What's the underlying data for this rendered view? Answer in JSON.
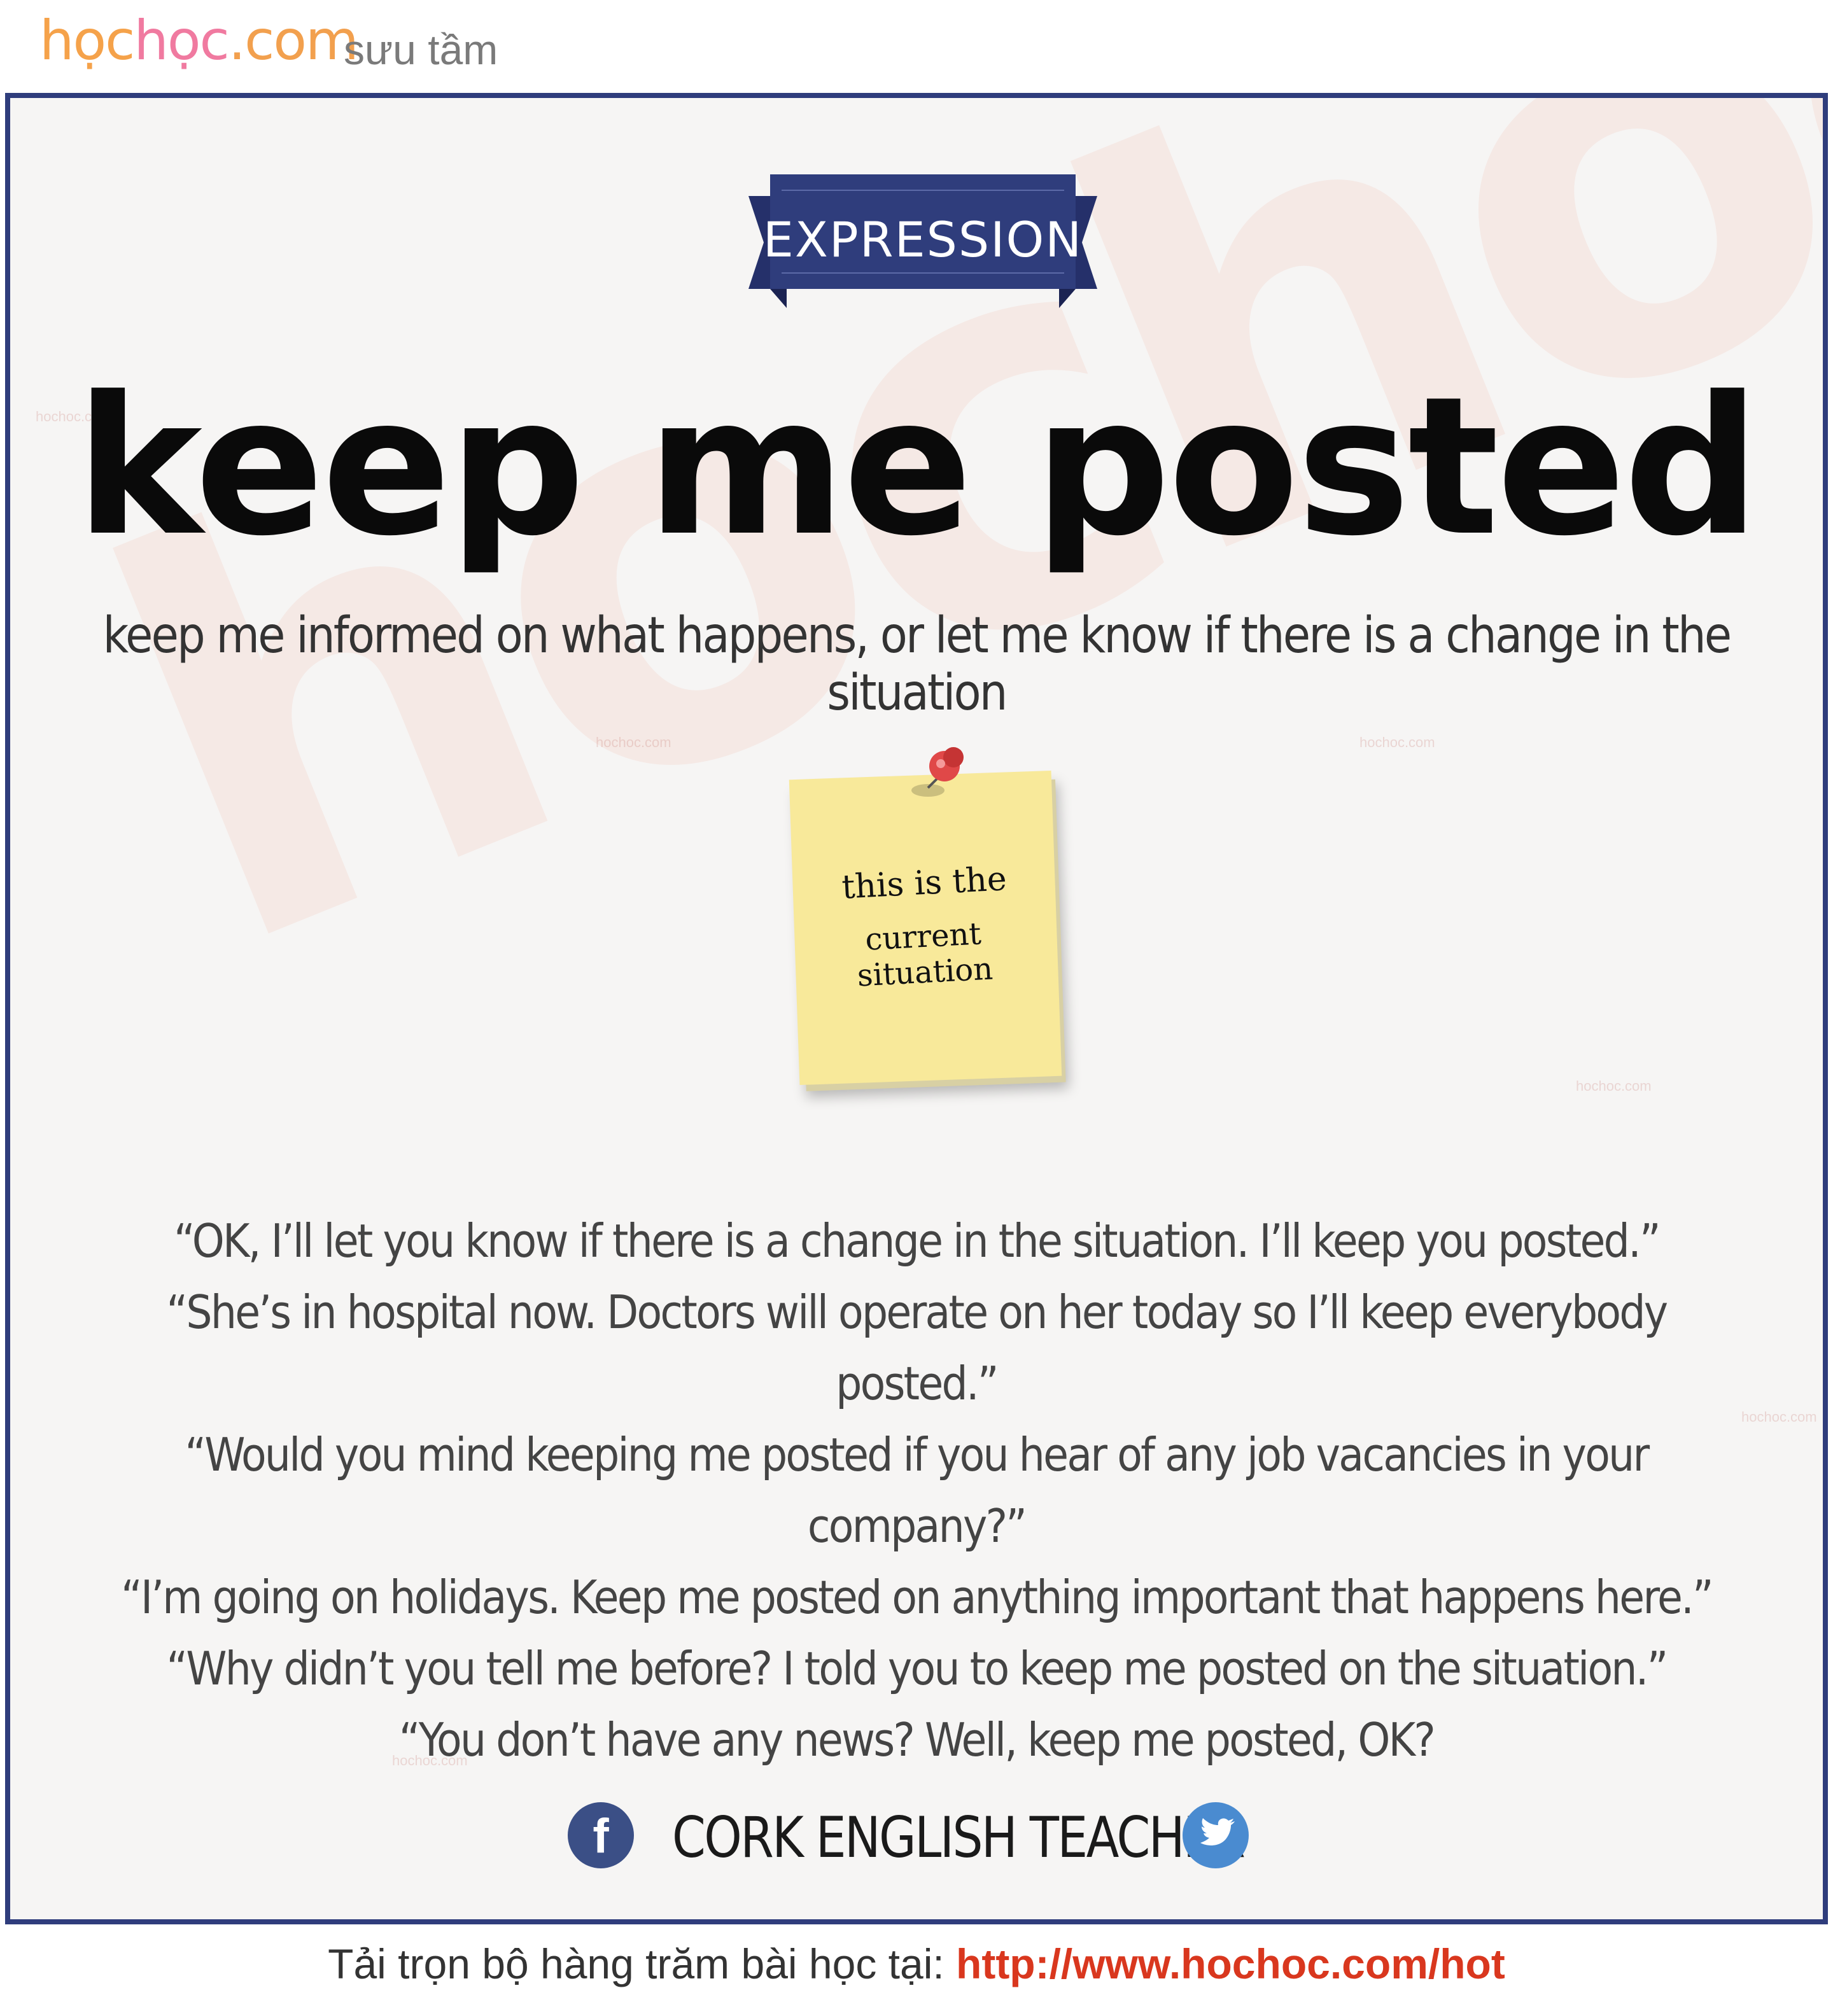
{
  "header": {
    "logo": {
      "part1": "học",
      "part2": "học",
      "part3": ".com"
    },
    "tagline": "sưu tầm"
  },
  "badge": {
    "label": "EXPRESSION",
    "color": "#2f3d7c"
  },
  "title": "keep me posted",
  "definition": "keep me informed on what happens, or let me know if there is a change in the situation",
  "sticky_note": {
    "line1": "this is the",
    "line2": "current situation",
    "paper_color": "#f8e99a",
    "pin_color": "#e04848"
  },
  "examples": [
    "“OK, I’ll let you know if there is a change in the situation. I’ll keep you posted.”",
    "“She’s in hospital now. Doctors will operate on her today so I’ll keep everybody posted.”",
    "“Would you mind keeping me posted if you hear of any job vacancies in your company?”",
    "“I’m going on holidays. Keep me posted on anything important that happens here.”",
    "“Why didn’t you tell me before? I told you to keep me posted on the situation.”",
    "“You don’t have any news? Well, keep me posted, OK?"
  ],
  "footer": {
    "facebook_icon": "facebook-icon",
    "brand": "CORK ENGLISH TEACHER",
    "twitter_icon": "twitter-icon"
  },
  "bottom": {
    "prefix": "Tải trọn bộ hàng trăm bài học tại: ",
    "link": "http://www.hochoc.com/hot"
  },
  "watermark": {
    "big": "hochoc.com",
    "small": "hochoc.com"
  }
}
